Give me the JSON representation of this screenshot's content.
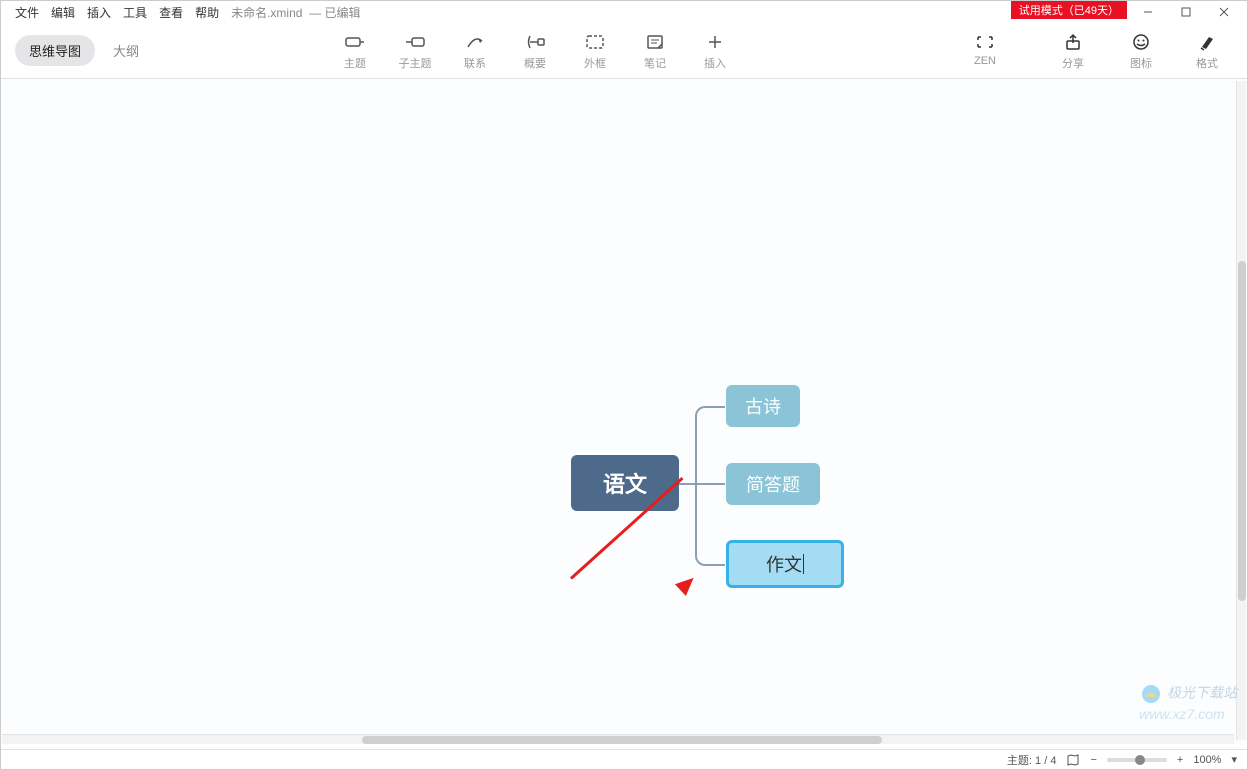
{
  "menu": {
    "file": "文件",
    "edit": "编辑",
    "insert": "插入",
    "tools": "工具",
    "view": "查看",
    "help": "帮助"
  },
  "doc": {
    "title": "未命名.xmind",
    "status": "— 已编辑"
  },
  "trial": "试用模式（已49天）",
  "tabs": {
    "mindmap": "思维导图",
    "outline": "大纲"
  },
  "tools": {
    "topic": "主题",
    "subtopic": "子主题",
    "relation": "联系",
    "summary": "概要",
    "boundary": "外框",
    "note": "笔记",
    "insert": "插入",
    "zen": "ZEN",
    "share": "分享",
    "icon": "图标",
    "format": "格式"
  },
  "mindmap": {
    "root": "语文",
    "node1": "古诗",
    "node2": "简答题",
    "node3": "作文"
  },
  "status": {
    "topic_count": "主题: 1 / 4",
    "zoom": "100%"
  },
  "watermark": {
    "text1": "极光下载站",
    "text2": "www.xz7.com"
  }
}
